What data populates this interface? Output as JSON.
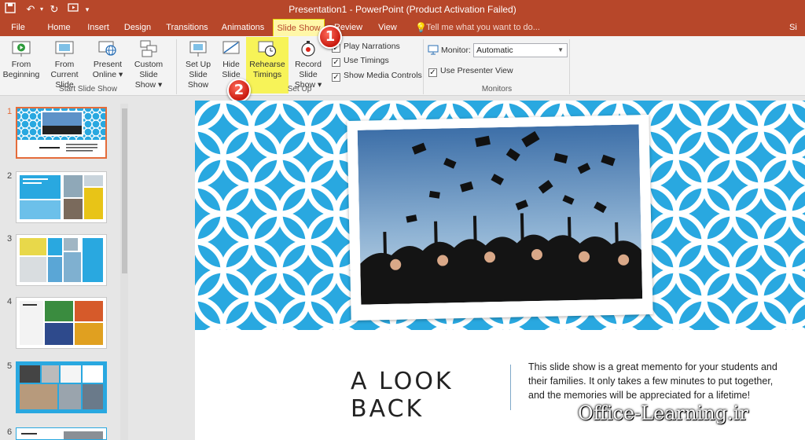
{
  "window": {
    "title": "Presentation1 - PowerPoint (Product Activation Failed)",
    "user_initial": "Si"
  },
  "tabs": [
    "File",
    "Home",
    "Insert",
    "Design",
    "Transitions",
    "Animations",
    "Slide Show",
    "Review",
    "View"
  ],
  "active_tab": "Slide Show",
  "tell_me": "Tell me what you want to do...",
  "ribbon": {
    "start": {
      "from_beginning": [
        "From",
        "Beginning"
      ],
      "from_current": [
        "From",
        "Current Slide"
      ],
      "present_online": [
        "Present",
        "Online ▾"
      ],
      "custom_show": [
        "Custom Slide",
        "Show ▾"
      ],
      "label": "Start Slide Show"
    },
    "setup": {
      "set_up": [
        "Set Up",
        "Slide Show"
      ],
      "hide": [
        "Hide",
        "Slide"
      ],
      "rehearse": [
        "Rehearse",
        "Timings"
      ],
      "record": [
        "Record Slide",
        "Show ▾"
      ],
      "play_narrations": "Play Narrations",
      "use_timings": "Use Timings",
      "show_media": "Show Media Controls",
      "label": "Set Up"
    },
    "monitors": {
      "monitor_label": "Monitor:",
      "monitor_value": "Automatic",
      "presenter_view": "Use Presenter View",
      "label": "Monitors"
    }
  },
  "badges": [
    "1",
    "2"
  ],
  "thumbnails": [
    "1",
    "2",
    "3",
    "4",
    "5",
    "6"
  ],
  "slide": {
    "title": "A LOOK BACK",
    "body": "This slide show is a great memento for your students and their families. It only takes a few minutes to put together, and the memories will be appreciated for a lifetime!",
    "thumb_title": "A LOOK BACK"
  },
  "watermark": "Office-Learning.ir",
  "colors": {
    "accent": "#b7472a",
    "highlight": "#f7f23c",
    "pattern_blue": "#29a8e0",
    "badge_red": "#d9251a"
  }
}
